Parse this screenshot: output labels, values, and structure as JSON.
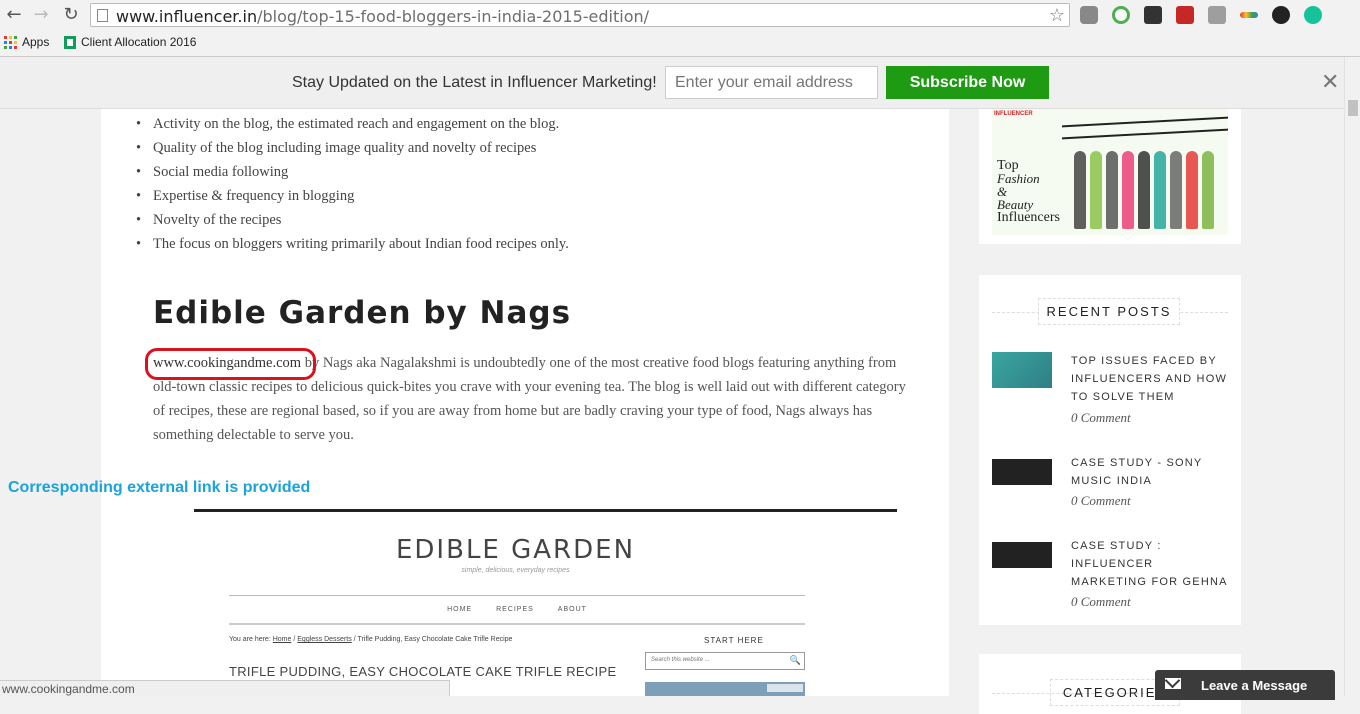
{
  "browser": {
    "url_host": "www.influencer.in",
    "url_path": "/blog/top-15-food-bloggers-in-india-2015-edition/",
    "bookmarks": [
      {
        "label": "Apps"
      },
      {
        "label": "Client Allocation 2016"
      }
    ],
    "status_bar": "www.cookingandme.com"
  },
  "subscribe_bar": {
    "message": "Stay Updated on the Latest in Influencer Marketing!",
    "email_placeholder": "Enter your email address",
    "button_label": "Subscribe Now",
    "close_glyph": "✕"
  },
  "article": {
    "bullets": [
      "Activity on the blog, the estimated reach and engagement on the blog.",
      "Quality of the blog including image quality and novelty of recipes",
      "Social media following",
      "Expertise & frequency in blogging",
      "Novelty of the recipes",
      "The focus on bloggers writing primarily about Indian food recipes only."
    ],
    "heading": "Edible Garden by Nags",
    "link_text": "www.cookingandme.com",
    "paragraph": " by Nags aka Nagalakshmi is undoubtedly one of the most creative food blogs featuring anything from old-town classic recipes to delicious quick-bites you crave with your evening tea. The blog is well laid out with different category of recipes, these are regional based, so if you are away from home but are badly craving your type of food, Nags always has something delectable to serve you."
  },
  "annotation": "Corresponding external link is provided",
  "embedded_screenshot": {
    "site_title": "EDIBLE GARDEN",
    "tagline": "simple, delicious, everyday recipes",
    "nav": [
      "HOME",
      "RECIPES",
      "ABOUT"
    ],
    "crumb_prefix": "You are here: ",
    "crumb_home": "Home",
    "crumb_sep1": " / ",
    "crumb_cat": "Eggless Desserts",
    "crumb_rest": " / Trifle Pudding, Easy Chocolate Cake Trifle Recipe",
    "start_here": "START HERE",
    "post_title": "TRIFLE PUDDING, EASY CHOCOLATE CAKE TRIFLE RECIPE",
    "search_placeholder": "Search this website ...",
    "search_glyph": "🔍"
  },
  "sidebar": {
    "banner": {
      "logo": "INFLUENCER",
      "line1": "Top",
      "line2": "Fashion",
      "line3": "&",
      "line4": "Beauty",
      "line5": "Influencers"
    },
    "recent_posts": {
      "title": "RECENT POSTS",
      "posts": [
        {
          "title": "TOP ISSUES FACED BY INFLUENCERS AND HOW TO SOLVE THEM",
          "comments": "0 Comment"
        },
        {
          "title": "CASE STUDY - SONY MUSIC INDIA",
          "comments": "0 Comment"
        },
        {
          "title": "CASE STUDY : INFLUENCER MARKETING FOR GEHNA",
          "comments": "0 Comment"
        }
      ]
    },
    "categories_title": "CATEGORIES"
  },
  "chat_widget": {
    "label": "Leave a Message"
  },
  "colors": {
    "subscribe_green": "#1e9b13",
    "annotation_blue": "#1aa3dc",
    "highlight_red": "#d8121f"
  }
}
